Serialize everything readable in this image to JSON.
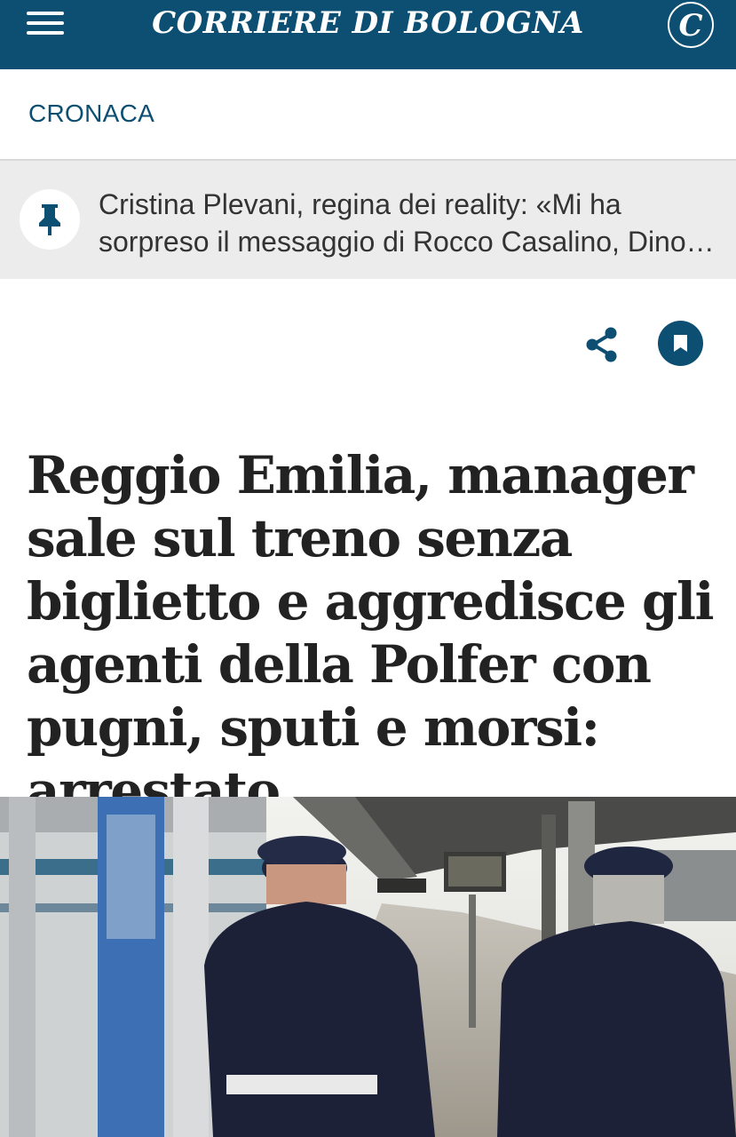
{
  "header": {
    "brand": "CORRIERE DI BOLOGNA",
    "logo_letter": "C",
    "menu_icon": "hamburger-menu-icon",
    "brand_color": "#0c4f72"
  },
  "section": {
    "label": "CRONACA"
  },
  "pinned": {
    "icon": "pushpin-icon",
    "text": "Cristina Plevani, regina dei reality: «Mi ha sorpreso il messaggio di Rocco Casalino, Dino Giarrusso e…"
  },
  "actions": {
    "share_icon": "share-icon",
    "bookmark_icon": "bookmark-icon"
  },
  "article": {
    "headline": "Reggio Emilia, manager sale sul treno senza biglietto e aggredisce gli agenti della Polfer con pugni, sputi e morsi: arrestato"
  }
}
